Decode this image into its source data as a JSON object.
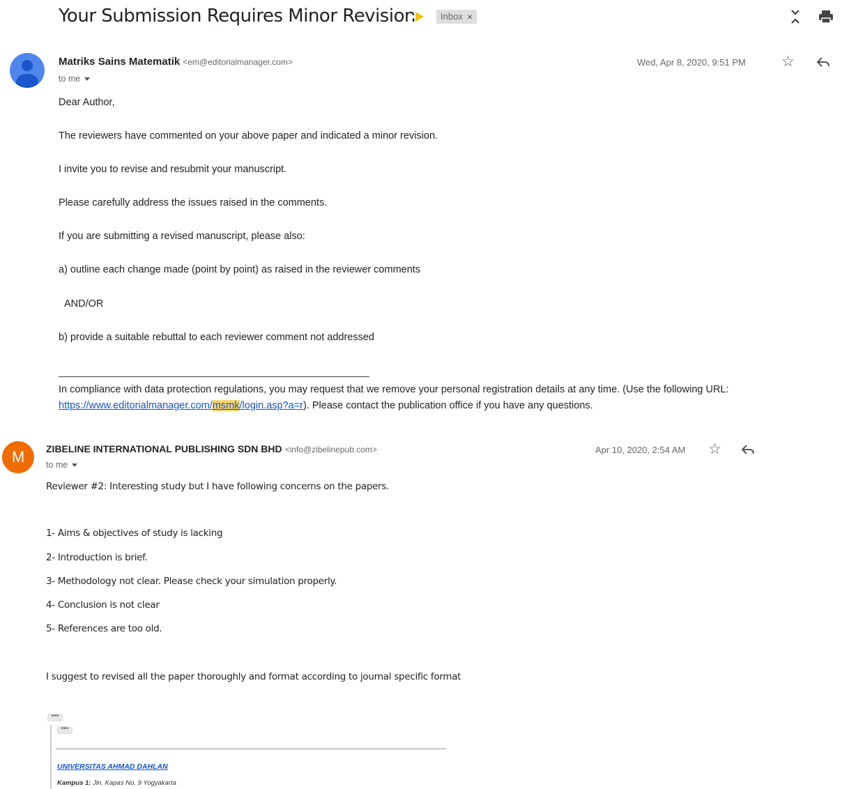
{
  "subject": "Your Submission Requires Minor Revision",
  "label": "Inbox",
  "messages": [
    {
      "sender": "Matriks Sains Matematik",
      "address": "<em@editorialmanager.com>",
      "to": "to me",
      "date": "Wed, Apr 8, 2020, 9:51 PM",
      "body": [
        "Dear Author,",
        "The reviewers have commented on your above paper and indicated a minor revision.",
        "I invite you to revise and resubmit your manuscript.",
        "Please carefully address the issues raised in the comments.",
        "If you are submitting a revised manuscript, please also:",
        "a) outline each change made (point by point) as raised in the reviewer comments",
        "AND/OR",
        "b) provide a suitable rebuttal to each reviewer comment not addressed"
      ],
      "compliance": {
        "text_before": "In compliance with data protection regulations, you may request that we remove your personal registration details at any time.  (Use the following URL:",
        "link_pre": "https://www.editorialmanager.com/",
        "link_highlight": "msmk",
        "link_post": "/login.asp?a=r",
        "text_after": "). Please contact the publication office if you have any questions."
      }
    },
    {
      "avatar_letter": "M",
      "sender": "ZIBELINE INTERNATIONAL PUBLISHING SDN BHD",
      "address": "<info@zibelinepub.com>",
      "to": "to me",
      "date": "Apr 10, 2020, 2:54 AM",
      "body": [
        "Reviewer #2: Interesting study but I have following concerns on the papers.",
        "1- Aims & objectives of study is lacking",
        "2- Introduction is brief.",
        "3- Methodology not clear. Please check your simulation properly.",
        "4- Conclusion is not clear",
        "5- References are too old.",
        "I suggest to revised all the paper thoroughly and format according to journal specific format"
      ],
      "ellipsis": "•••",
      "signature": {
        "university": "UNIVERSITAS AHMAD DAHLAN",
        "campus_label": "Kampus 1:",
        "campus_address": "Jln. Kapas No. 9 Yogyakarta"
      }
    }
  ],
  "icons": {
    "collapse": "collapse-all-icon",
    "print": "print-icon",
    "star": "star-icon",
    "reply": "reply-icon",
    "important": "important-marker-icon",
    "dropdown": "chevron-down-icon"
  },
  "colors": {
    "link": "#1155cc",
    "avatar_person": "#4f86ec",
    "avatar_m": "#ef6c00",
    "important": "#f4c20d",
    "highlight": "#f7d56a"
  }
}
